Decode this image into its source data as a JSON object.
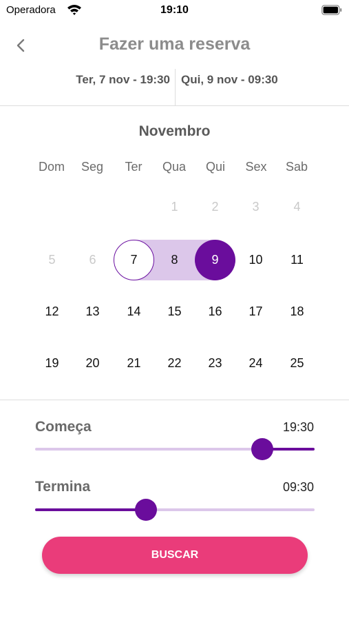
{
  "status_bar": {
    "carrier": "Operadora",
    "time": "19:10",
    "icons": [
      "wifi-icon",
      "battery-icon"
    ]
  },
  "header": {
    "back_icon": "chevron-left-icon",
    "title": "Fazer uma reserva"
  },
  "date_range": {
    "start": "Ter, 7 nov - 19:30",
    "end": "Qui, 9 nov - 09:30"
  },
  "calendar": {
    "month": "Novembro",
    "weekdays": [
      "Dom",
      "Seg",
      "Ter",
      "Qua",
      "Qui",
      "Sex",
      "Sab"
    ],
    "weeks": [
      [
        "",
        "",
        "",
        "1",
        "2",
        "3",
        "4"
      ],
      [
        "5",
        "6",
        "7",
        "8",
        "9",
        "10",
        "11"
      ],
      [
        "12",
        "13",
        "14",
        "15",
        "16",
        "17",
        "18"
      ],
      [
        "19",
        "20",
        "21",
        "22",
        "23",
        "24",
        "25"
      ]
    ],
    "disabled_days": [
      "1",
      "2",
      "3",
      "4",
      "5",
      "6"
    ],
    "range_start_day": "7",
    "range_end_day": "9"
  },
  "sliders": {
    "start": {
      "label": "Começa",
      "value": "19:30",
      "fraction": 0.8125
    },
    "end": {
      "label": "Termina",
      "value": "09:30",
      "fraction": 0.396
    }
  },
  "search_button": {
    "label": "BUSCAR"
  },
  "colors": {
    "accent": "#6a0d9c",
    "accent_light": "#dcc7ea",
    "button": "#ea3c7a"
  }
}
